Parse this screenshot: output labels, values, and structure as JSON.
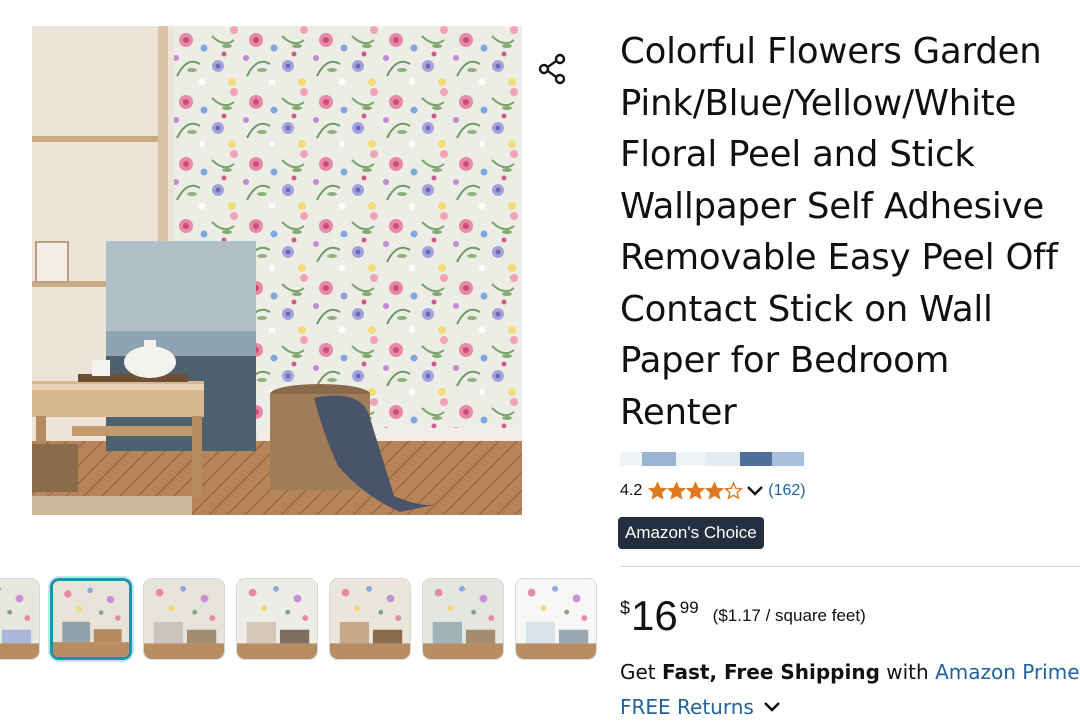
{
  "product": {
    "title": "Colorful Flowers Garden Pink/Blue/Yellow/White Floral Peel and Stick Wallpaper Self Adhesive Removable Easy Peel Off Contact Stick on Wall Paper for Bedroom Renter",
    "rating_value": "4.2",
    "rating_stars": 4.2,
    "rating_count": "(162)",
    "badge": "Amazon's Choice",
    "price": {
      "symbol": "$",
      "whole": "16",
      "fraction": "99",
      "unit_price": "($1.17 / square feet)"
    },
    "shipping": {
      "prefix": "Get ",
      "bold": "Fast, Free Shipping",
      "middle": " with ",
      "link": "Amazon Prime"
    },
    "returns": "FREE Returns"
  },
  "swatch_colors": [
    "#eef3f7",
    "#9bb3d2",
    "#eef3f7",
    "#e3ecf0",
    "#4d6f9a",
    "#a9bfde"
  ],
  "colors": {
    "link": "#2162a1",
    "star": "#de7921",
    "badge_bg": "#232f3e",
    "thumb_selected": "#1c93a8"
  },
  "icons": {
    "share": "share-icon",
    "chevron": "chevron-down-icon",
    "star": "star-icon"
  },
  "thumbnails": [
    {
      "name": "thumb-1",
      "selected": false
    },
    {
      "name": "thumb-2",
      "selected": true
    },
    {
      "name": "thumb-3",
      "selected": false
    },
    {
      "name": "thumb-4",
      "selected": false
    },
    {
      "name": "thumb-5",
      "selected": false
    },
    {
      "name": "thumb-6",
      "selected": false
    },
    {
      "name": "thumb-7",
      "selected": false
    }
  ]
}
